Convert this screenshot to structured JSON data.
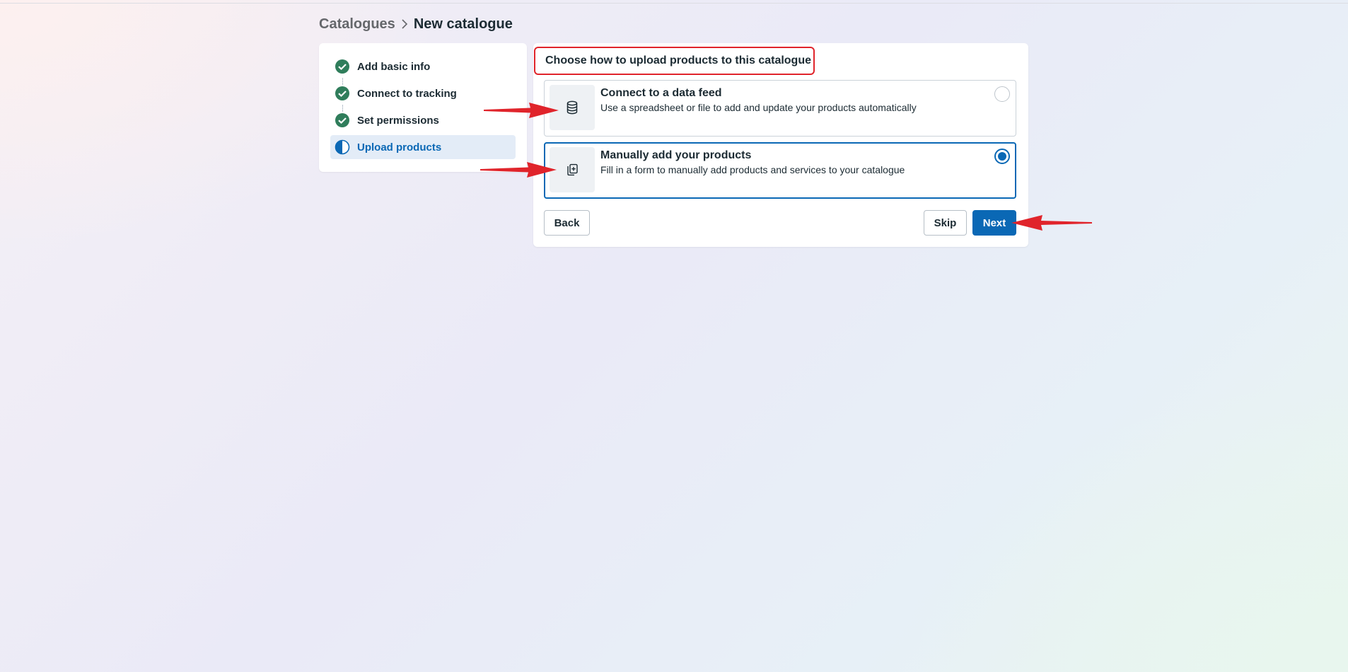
{
  "breadcrumb": {
    "parent": "Catalogues",
    "separator_icon": "chevron-right-icon",
    "current": "New catalogue"
  },
  "steps": [
    {
      "label": "Add basic info",
      "status": "complete",
      "icon": "check-circle-icon"
    },
    {
      "label": "Connect to tracking",
      "status": "complete",
      "icon": "check-circle-icon"
    },
    {
      "label": "Set permissions",
      "status": "complete",
      "icon": "check-circle-icon"
    },
    {
      "label": "Upload products",
      "status": "in-progress",
      "icon": "half-circle-icon"
    }
  ],
  "main": {
    "title": "Choose how to upload products to this catalogue",
    "options": [
      {
        "title": "Connect to a data feed",
        "description": "Use a spreadsheet or file to add and update your products automatically",
        "icon": "database-icon",
        "selected": false
      },
      {
        "title": "Manually add your products",
        "description": "Fill in a form to manually add products and services to your catalogue",
        "icon": "add-product-icon",
        "selected": true
      }
    ],
    "buttons": {
      "back": "Back",
      "skip": "Skip",
      "next": "Next"
    }
  },
  "colors": {
    "accent": "#0a68b5",
    "complete": "#2f7d5b",
    "annotation": "#e0242b"
  }
}
